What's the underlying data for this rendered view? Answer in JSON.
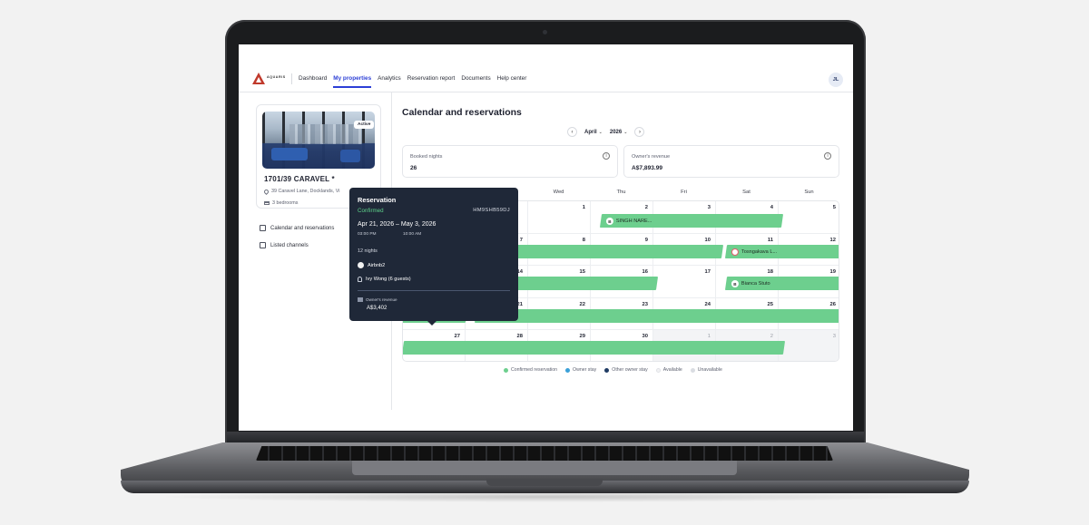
{
  "nav": {
    "logo_text": "AQUARIS",
    "items": [
      {
        "label": "Dashboard",
        "active": false
      },
      {
        "label": "My properties",
        "active": true
      },
      {
        "label": "Analytics",
        "active": false
      },
      {
        "label": "Reservation report",
        "active": false
      },
      {
        "label": "Documents",
        "active": false
      },
      {
        "label": "Help center",
        "active": false
      }
    ],
    "avatar_initials": "JL"
  },
  "property": {
    "status": "Active",
    "title": "1701/39 CARAVEL *",
    "address": "39 Caravel Lane, Docklands, Vi",
    "bedrooms": "3 bedrooms"
  },
  "side_links": [
    {
      "label": "Calendar and reservations",
      "icon": "calendar-icon"
    },
    {
      "label": "Listed channels",
      "icon": "channels-icon"
    }
  ],
  "main": {
    "title": "Calendar and reservations",
    "month": "April",
    "year": "2026",
    "prev_icon": "‹",
    "next_icon": "›"
  },
  "stats": [
    {
      "label": "Booked nights",
      "value": "26"
    },
    {
      "label": "Owner's revenue",
      "value": "A$7,893.99"
    }
  ],
  "weekdays": [
    "Mon",
    "Tue",
    "Wed",
    "Thu",
    "Fri",
    "Sat",
    "Sun"
  ],
  "calendar": {
    "rows": [
      [
        {
          "d": ""
        },
        {
          "d": ""
        },
        {
          "d": "1"
        },
        {
          "d": "2"
        },
        {
          "d": "3"
        },
        {
          "d": "4"
        },
        {
          "d": "5"
        }
      ],
      [
        {
          "d": "6"
        },
        {
          "d": "7"
        },
        {
          "d": "8"
        },
        {
          "d": "9"
        },
        {
          "d": "10"
        },
        {
          "d": "11"
        },
        {
          "d": "12"
        }
      ],
      [
        {
          "d": "13"
        },
        {
          "d": "14"
        },
        {
          "d": "15"
        },
        {
          "d": "16"
        },
        {
          "d": "17"
        },
        {
          "d": "18"
        },
        {
          "d": "19"
        }
      ],
      [
        {
          "d": "20"
        },
        {
          "d": "21"
        },
        {
          "d": "22"
        },
        {
          "d": "23"
        },
        {
          "d": "24"
        },
        {
          "d": "25"
        },
        {
          "d": "26"
        }
      ],
      [
        {
          "d": "27"
        },
        {
          "d": "28"
        },
        {
          "d": "29"
        },
        {
          "d": "30"
        },
        {
          "d": "1",
          "out": true
        },
        {
          "d": "2",
          "out": true
        },
        {
          "d": "3",
          "out": true
        }
      ]
    ],
    "reservations": [
      {
        "guest": "SINGH NARE...",
        "channel": "B"
      },
      {
        "guest": "Tosngakava L...",
        "channel": "airbnb"
      },
      {
        "guest": "Bianca Stuto",
        "channel": "B"
      }
    ]
  },
  "legend": [
    {
      "label": "Confirmed reservation",
      "color": "#6dcf8e"
    },
    {
      "label": "Owner stay",
      "color": "#3aa0d8"
    },
    {
      "label": "Other owner stay",
      "color": "#1f3b63"
    },
    {
      "label": "Available",
      "color": "#f2f3f5"
    },
    {
      "label": "Unavailable",
      "color": "#dadde2"
    }
  ],
  "tooltip": {
    "heading": "Reservation",
    "status": "Confirmed",
    "code": "HM9SHB59DJ",
    "dates": "Apr 21, 2026  –  May 3, 2026",
    "checkin_time": "03:00 PM",
    "checkout_time": "10:00 AM",
    "nights": "12 nights",
    "channel": "Airbnb2",
    "guest": "Ivy Wong  (6 guests)",
    "revenue_label": "Owner's revenue",
    "revenue_value": "A$3,402"
  }
}
